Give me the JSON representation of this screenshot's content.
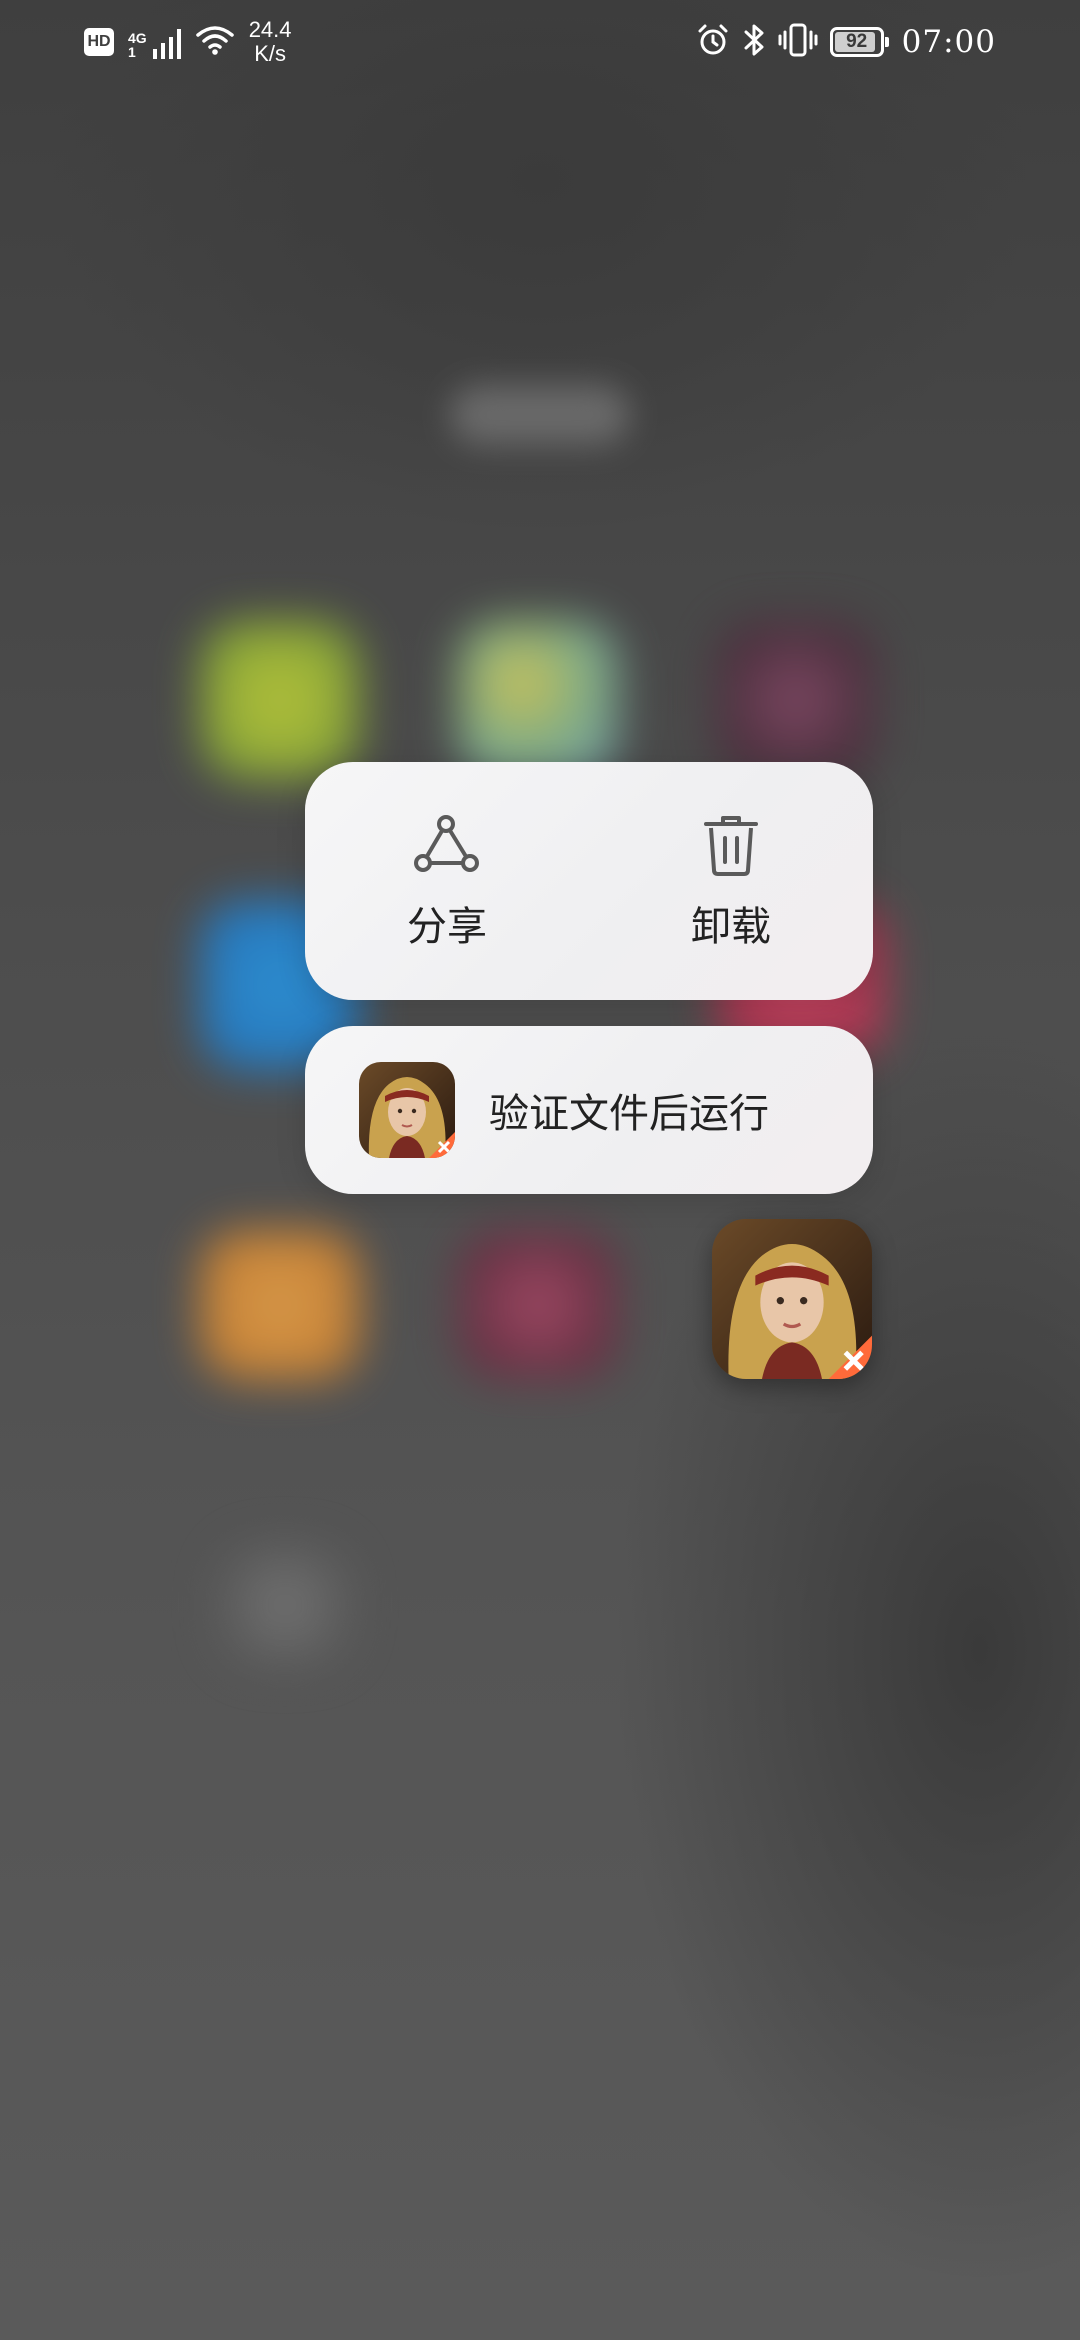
{
  "status_bar": {
    "hd": "HD",
    "network_type": "4G",
    "network_sub": "1",
    "speed_value": "24.4",
    "speed_unit": "K/s",
    "battery": "92",
    "battery_level": 0.92,
    "time": "07:00",
    "icons": [
      "hd-icon",
      "signal-icon",
      "wifi-icon",
      "alarm-icon",
      "bluetooth-icon",
      "vibrate-icon",
      "battery-icon"
    ]
  },
  "context_menu": {
    "actions": [
      {
        "label": "分享",
        "icon": "share-icon"
      },
      {
        "label": "卸载",
        "icon": "trash-icon"
      }
    ],
    "shortcut": {
      "label": "验证文件后运行",
      "icon": "game-app-icon"
    }
  },
  "colors": {
    "card_background": "#f3f3f4",
    "text": "#222222",
    "icon_stroke": "#5a5a5a"
  }
}
